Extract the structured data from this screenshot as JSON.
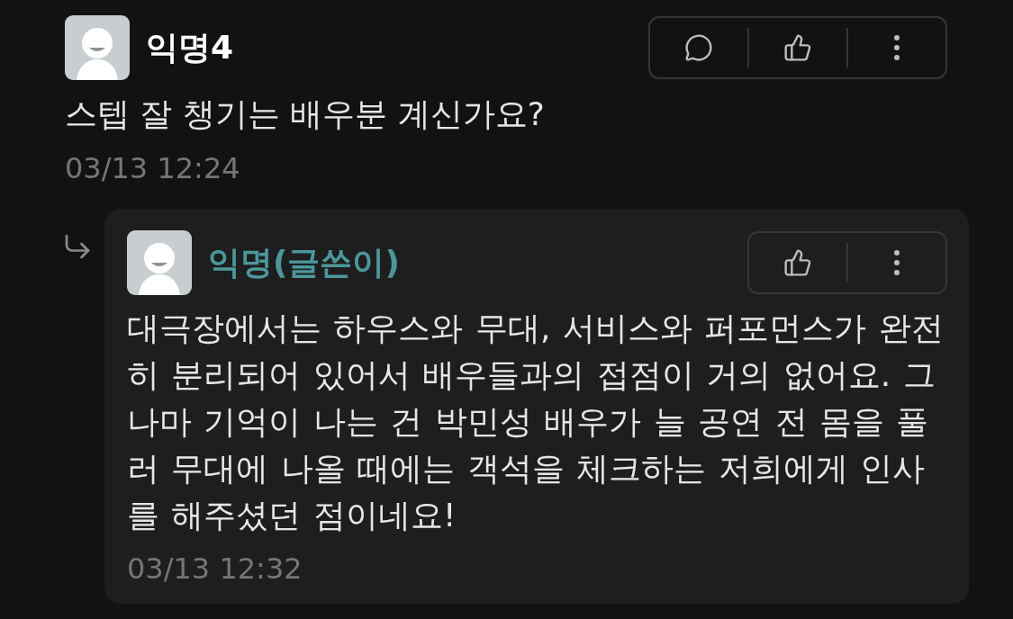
{
  "comment": {
    "author": "익명4",
    "is_author": false,
    "body": "스텝 잘 챙기는 배우분 계신가요?",
    "time": "03/13 12:24",
    "actions": [
      {
        "kind": "comment"
      },
      {
        "kind": "like"
      },
      {
        "kind": "more"
      }
    ]
  },
  "reply": {
    "author": "익명(글쓴이)",
    "is_author": true,
    "body": "대극장에서는 하우스와 무대, 서비스와 퍼포먼스가 완전히 분리되어 있어서 배우들과의 접점이 거의 없어요. 그나마 기억이 나는 건 박민성 배우가 늘 공연 전 몸을 풀러 무대에 나올 때에는 객석을 체크하는 저희에게 인사를 해주셨던 점이네요!",
    "time": "03/13 12:32",
    "actions": [
      {
        "kind": "like"
      },
      {
        "kind": "more"
      }
    ]
  }
}
